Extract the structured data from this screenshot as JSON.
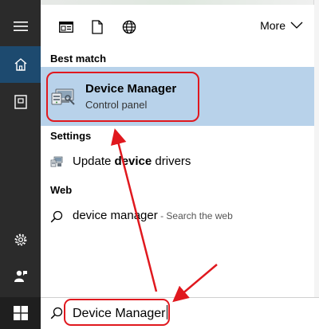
{
  "rail": {
    "menu_icon": "hamburger-menu-icon",
    "home_icon": "home-icon",
    "documents_icon": "notebook-icon",
    "settings_icon": "gear-icon",
    "feedback_icon": "feedback-icon"
  },
  "filters": {
    "apps_icon": "apps-icon",
    "documents_icon": "document-icon",
    "web_icon": "globe-icon",
    "more_label": "More"
  },
  "sections": {
    "best_match": "Best match",
    "settings": "Settings",
    "web": "Web"
  },
  "best_match": {
    "title": "Device Manager",
    "subtitle": "Control panel",
    "icon": "device-manager-icon"
  },
  "settings_result": {
    "prefix": "Update ",
    "bold": "device",
    "suffix": " drivers",
    "icon": "device-drivers-icon"
  },
  "web_result": {
    "query": "device manager",
    "hint": " - Search the web",
    "icon": "search-icon"
  },
  "taskbar": {
    "start_icon": "windows-logo-icon",
    "search_value": "Device Manager",
    "search_icon": "search-icon"
  },
  "colors": {
    "rail": "#2b2b2b",
    "rail_active": "#1d4a6f",
    "selection": "#b8d2ea",
    "annotation": "#e0181e"
  }
}
